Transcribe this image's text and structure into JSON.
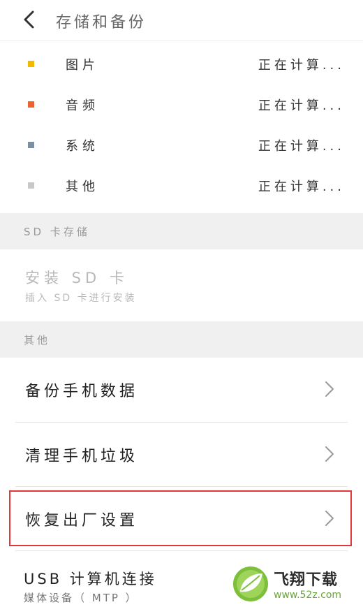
{
  "header": {
    "title": "存储和备份"
  },
  "usage": [
    {
      "label": "图片",
      "value": "正在计算...",
      "color": "#f5b800"
    },
    {
      "label": "音频",
      "value": "正在计算...",
      "color": "#f0622d"
    },
    {
      "label": "系统",
      "value": "正在计算...",
      "color": "#7a8fa3"
    },
    {
      "label": "其他",
      "value": "正在计算...",
      "color": "#c8c8c8"
    }
  ],
  "sd_section": {
    "header": "SD 卡存储",
    "title": "安装 SD 卡",
    "subtitle": "插入 SD 卡进行安装"
  },
  "other_section": {
    "header": "其他"
  },
  "menu": [
    {
      "label": "备份手机数据"
    },
    {
      "label": "清理手机垃圾"
    },
    {
      "label": "恢复出厂设置"
    }
  ],
  "usb": {
    "title": "USB 计算机连接",
    "subtitle": "媒体设备（ MTP ）"
  },
  "watermark": {
    "name": "飞翔下载",
    "url": "www.52z.com"
  }
}
